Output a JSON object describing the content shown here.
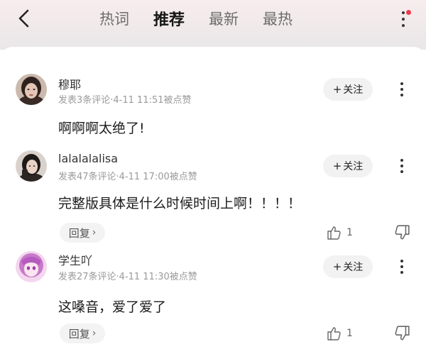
{
  "header": {
    "tabs": [
      {
        "label": "热词",
        "active": false
      },
      {
        "label": "推荐",
        "active": true
      },
      {
        "label": "最新",
        "active": false
      },
      {
        "label": "最热",
        "active": false
      }
    ],
    "notification_color": "#ef3a4a"
  },
  "comments": [
    {
      "username": "穆耶",
      "meta": "发表3条评论·4-11 11:51被点赞",
      "follow_label": "关注",
      "text": "啊啊啊太绝了!",
      "avatar_icon": "user-photo-avatar"
    },
    {
      "username": "lalalalalisa",
      "meta": "发表47条评论·4-11 17:00被点赞",
      "follow_label": "关注",
      "text": "完整版具体是什么时候时间上啊！！！！",
      "reply_label": "回复",
      "like_count": "1",
      "avatar_icon": "user-photo-avatar"
    },
    {
      "username": "学生吖",
      "meta": "发表27条评论·4-11 11:30被点赞",
      "follow_label": "关注",
      "text": "这嗓音，爱了爱了",
      "reply_label": "回复",
      "like_count": "1",
      "avatar_icon": "anime-avatar"
    }
  ]
}
